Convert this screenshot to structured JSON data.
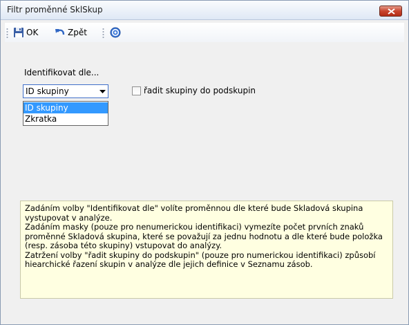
{
  "window": {
    "title": "Filtr proměnné SklSkup"
  },
  "toolbar": {
    "ok_label": "OK",
    "back_label": "Zpět"
  },
  "form": {
    "identify_label": "Identifikovat dle...",
    "combo_value": "ID skupiny",
    "options": [
      "ID skupiny",
      "Zkratka"
    ],
    "checkbox_label": "řadit skupiny do podskupin",
    "checkbox_checked": false
  },
  "help": {
    "lines": [
      "Zadáním volby \"Identifikovat dle\" volíte proměnnou dle které bude Skladová skupina vystupovat v analýze.",
      "Zadáním masky (pouze pro nenumerickou identifikaci) vymezíte počet prvních znaků proměnné Skladová skupina, které se považují za jednu hodnotu a dle které bude položka (resp. zásoba této skupiny)  vstupovat do analýzy.",
      "Zatržení volby \"řadit skupiny do podskupin\" (pouze pro numerickou identifikaci) způsobí hiearchické řazení skupin v analýze dle jejich definice v Seznamu zásob."
    ]
  },
  "colors": {
    "selection": "#3399ff",
    "info_background": "#ffffe1",
    "close_button": "#c8452e"
  },
  "icons": [
    "save-icon",
    "undo-icon",
    "help-icon",
    "close-icon",
    "chevron-down-icon"
  ]
}
